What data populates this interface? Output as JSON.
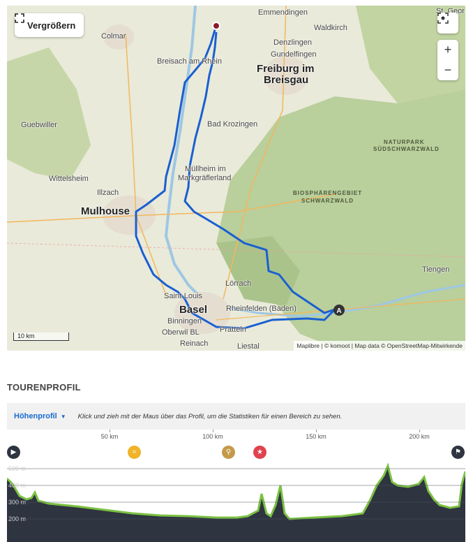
{
  "map": {
    "enlarge_label": "Vergrößern",
    "attribution": "Maplibre | © komoot | Map data © OpenStreetMap-Mitwirkende",
    "scale_label": "10 km",
    "zoom_in": "+",
    "zoom_out": "−",
    "start_marker": "A",
    "places": {
      "emmendingen": "Emmendingen",
      "waldkirch": "Waldkirch",
      "denzlingen": "Denzlingen",
      "gundelfingen": "Gundelfingen",
      "freiburg": "Freiburg im",
      "breisgau": "Breisgau",
      "colmar": "Colmar",
      "breisach": "Breisach am Rhein",
      "bad_krozingen": "Bad Krozingen",
      "guebwiller": "Guebwiller",
      "muellheim1": "Müllheim im",
      "muellheim2": "Markgräflerland",
      "wittelsheim": "Wittelsheim",
      "illzach": "Illzach",
      "mulhouse": "Mulhouse",
      "naturpark1": "NATURPARK",
      "naturpark2": "SÜDSCHWARZWALD",
      "biosphaere1": "BIOSPHÄRENGEBIET",
      "biosphaere2": "SCHWARZWALD",
      "tiengen": "Tiengen",
      "loerrach": "Lörrach",
      "saint_louis": "Saint-Louis",
      "basel": "Basel",
      "rheinfelden": "Rheinfelden (Baden)",
      "binningen": "Binningen",
      "oberwil": "Oberwil BL",
      "reinach": "Reinach",
      "pratteln": "Pratteln",
      "liestal": "Liestal",
      "st_georgen": "St. Geor"
    }
  },
  "profile": {
    "section_title": "TOURENPROFIL",
    "select_label": "Höhenprofil",
    "hint": "Klick und zieh mit der Maus über das Profil, um die Statistiken für einen Bereich zu sehen.",
    "km_ticks": [
      "50 km",
      "100 km",
      "150 km",
      "200 km"
    ],
    "y_labels": [
      "500 m",
      "400 m",
      "300 m",
      "200 m"
    ],
    "colors": {
      "fill": "#2e3440",
      "line": "#7bc142",
      "route": "#1a5fd1"
    },
    "icons": [
      "play-icon",
      "waves-icon",
      "bike-icon",
      "star-icon",
      "finish-flag-icon"
    ]
  }
}
